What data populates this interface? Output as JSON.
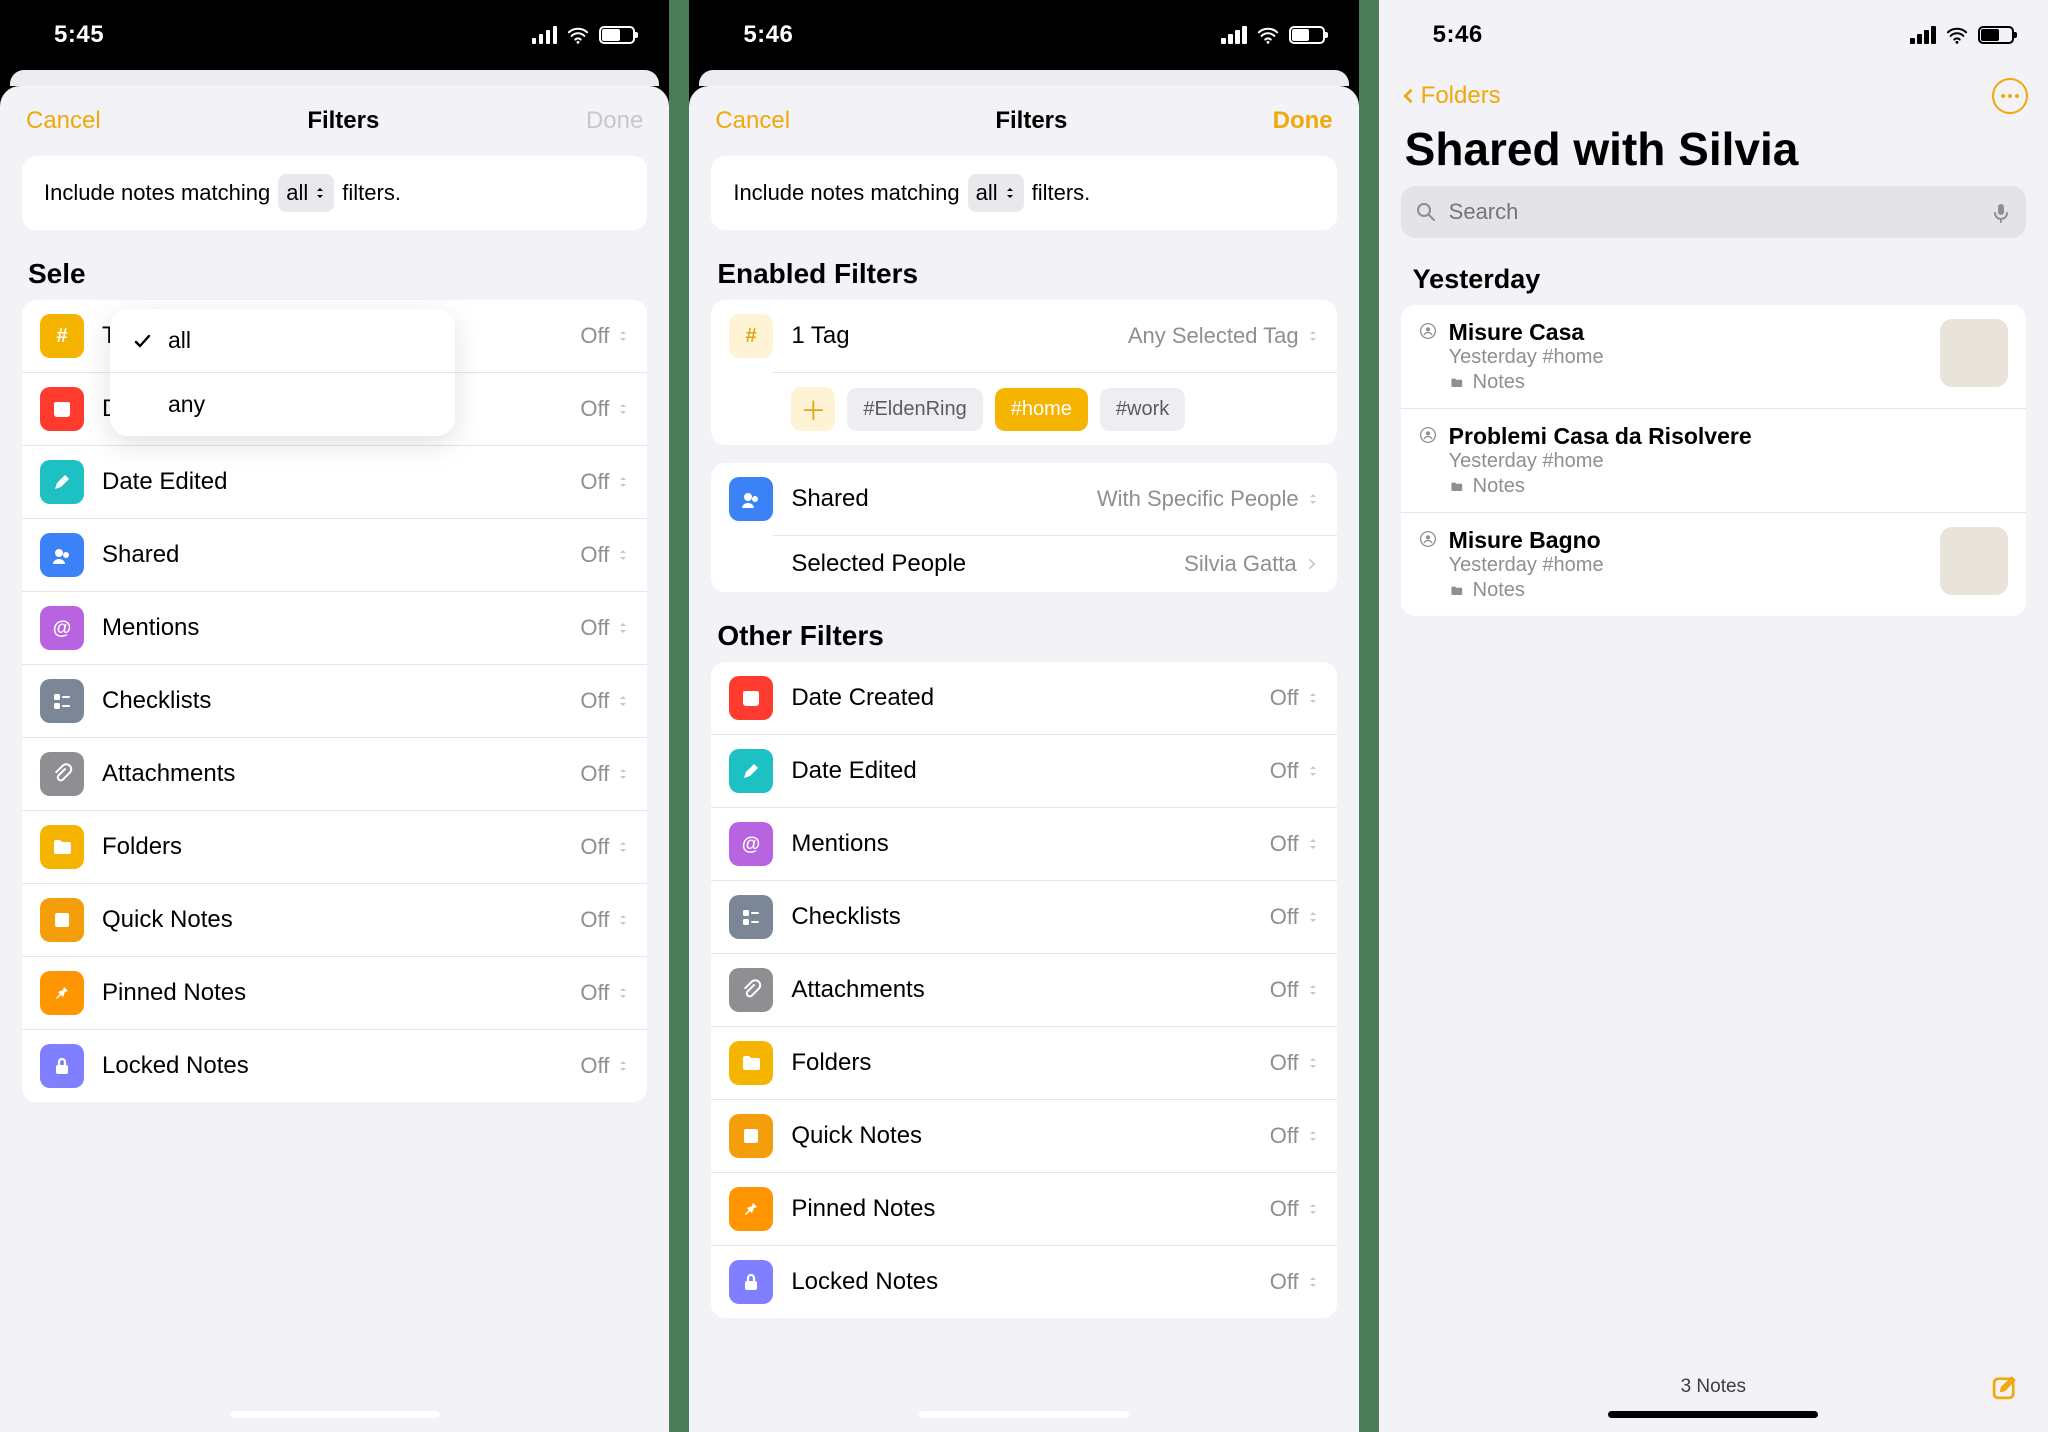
{
  "panel1": {
    "status_time": "5:45",
    "nav": {
      "cancel": "Cancel",
      "title": "Filters",
      "done": "Done",
      "done_enabled": false
    },
    "match": {
      "prefix": "Include notes matching",
      "value": "all",
      "suffix": "filters."
    },
    "popup": {
      "options": [
        "all",
        "any"
      ],
      "selected": "all"
    },
    "section_title_visible": "Sele",
    "filters": [
      {
        "icon": "hash-icon",
        "bg": "bg-tag",
        "label": "Tags",
        "value": "Off"
      },
      {
        "icon": "calendar-icon",
        "bg": "bg-red",
        "label": "Date Created",
        "value": "Off"
      },
      {
        "icon": "pencil-icon",
        "bg": "bg-teal",
        "label": "Date Edited",
        "value": "Off"
      },
      {
        "icon": "shared-icon",
        "bg": "bg-blue",
        "label": "Shared",
        "value": "Off"
      },
      {
        "icon": "at-icon",
        "bg": "bg-purple",
        "label": "Mentions",
        "value": "Off"
      },
      {
        "icon": "checklist-icon",
        "bg": "bg-grayblue",
        "label": "Checklists",
        "value": "Off"
      },
      {
        "icon": "paperclip-icon",
        "bg": "bg-gray",
        "label": "Attachments",
        "value": "Off"
      },
      {
        "icon": "folder-icon",
        "bg": "bg-folder",
        "label": "Folders",
        "value": "Off"
      },
      {
        "icon": "quicknote-icon",
        "bg": "bg-amber",
        "label": "Quick Notes",
        "value": "Off"
      },
      {
        "icon": "pin-icon",
        "bg": "bg-orange",
        "label": "Pinned Notes",
        "value": "Off"
      },
      {
        "icon": "lock-icon",
        "bg": "bg-indigo",
        "label": "Locked Notes",
        "value": "Off"
      }
    ]
  },
  "panel2": {
    "status_time": "5:46",
    "nav": {
      "cancel": "Cancel",
      "title": "Filters",
      "done": "Done",
      "done_enabled": true
    },
    "match": {
      "prefix": "Include notes matching",
      "value": "all",
      "suffix": "filters."
    },
    "sect_enabled": "Enabled Filters",
    "tag_filter": {
      "label": "1 Tag",
      "value": "Any Selected Tag"
    },
    "tags": [
      "#EldenRing",
      "#home",
      "#work"
    ],
    "tag_selected": "#home",
    "shared_filter": {
      "label": "Shared",
      "value": "With Specific People"
    },
    "selected_people": {
      "label": "Selected People",
      "value": "Silvia Gatta"
    },
    "sect_other": "Other Filters",
    "other": [
      {
        "icon": "calendar-icon",
        "bg": "bg-red",
        "label": "Date Created",
        "value": "Off"
      },
      {
        "icon": "pencil-icon",
        "bg": "bg-teal",
        "label": "Date Edited",
        "value": "Off"
      },
      {
        "icon": "at-icon",
        "bg": "bg-purple",
        "label": "Mentions",
        "value": "Off"
      },
      {
        "icon": "checklist-icon",
        "bg": "bg-grayblue",
        "label": "Checklists",
        "value": "Off"
      },
      {
        "icon": "paperclip-icon",
        "bg": "bg-gray",
        "label": "Attachments",
        "value": "Off"
      },
      {
        "icon": "folder-icon",
        "bg": "bg-folder",
        "label": "Folders",
        "value": "Off"
      },
      {
        "icon": "quicknote-icon",
        "bg": "bg-amber",
        "label": "Quick Notes",
        "value": "Off"
      },
      {
        "icon": "pin-icon",
        "bg": "bg-orange",
        "label": "Pinned Notes",
        "value": "Off"
      },
      {
        "icon": "lock-icon",
        "bg": "bg-indigo",
        "label": "Locked Notes",
        "value": "Off"
      }
    ]
  },
  "panel3": {
    "status_time": "5:46",
    "back_label": "Folders",
    "title": "Shared with Silvia",
    "search_placeholder": "Search",
    "day_section": "Yesterday",
    "notes": [
      {
        "title": "Misure Casa",
        "meta": "Yesterday  #home",
        "folder": "Notes",
        "thumb": true
      },
      {
        "title": "Problemi Casa da Risolvere",
        "meta": "Yesterday  #home",
        "folder": "Notes",
        "thumb": false
      },
      {
        "title": "Misure Bagno",
        "meta": "Yesterday  #home",
        "folder": "Notes",
        "thumb": true
      }
    ],
    "note_count": "3 Notes"
  }
}
